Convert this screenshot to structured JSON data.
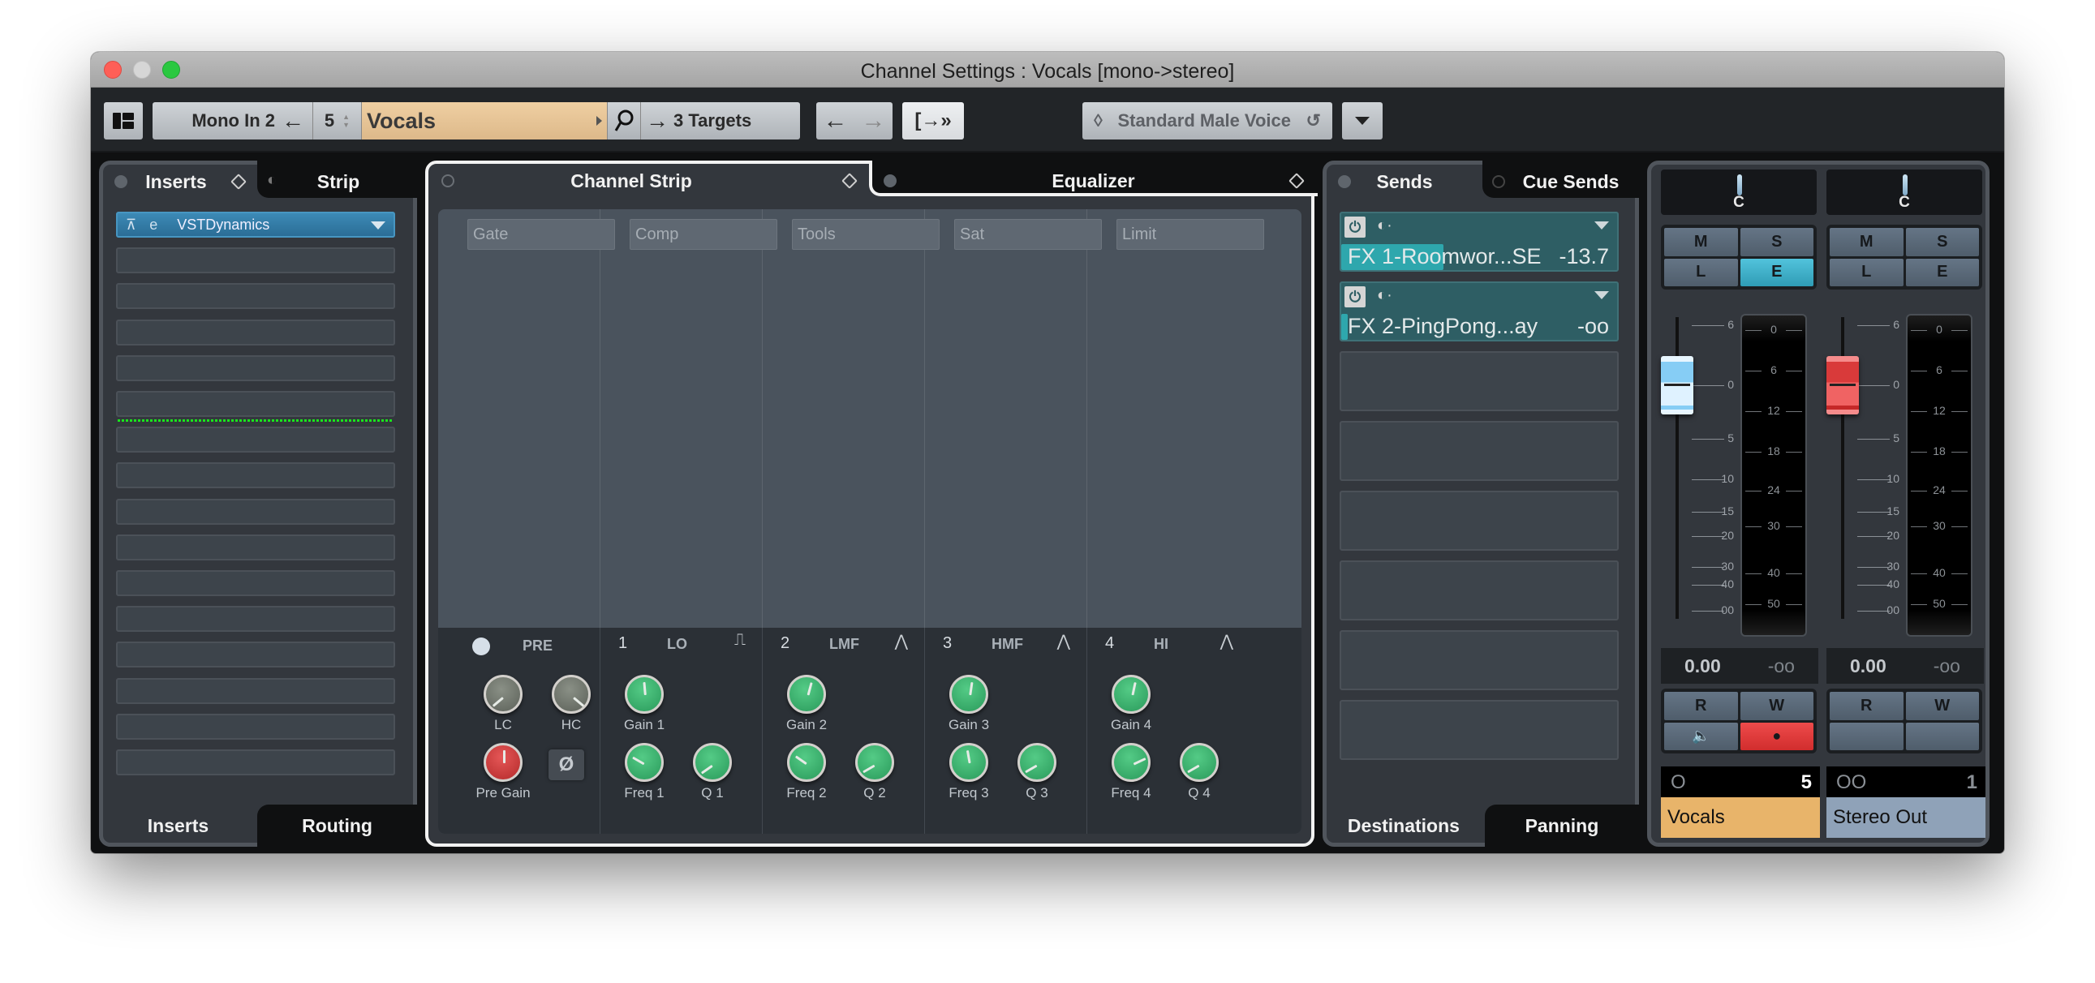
{
  "window": {
    "title": "Channel Settings : Vocals [mono->stereo]"
  },
  "toolbar": {
    "layout_icon": "layout-icon",
    "input_routing": "Mono In 2",
    "input_arrow": "←",
    "channel_number": "5",
    "channel_name": "Vocals",
    "search_icon": "⚲",
    "output_arrow": "→",
    "output_targets": "3 Targets",
    "nav_back": "←",
    "nav_forward": "→",
    "export_icon": "[→»",
    "preset_name": "Standard Male Voice",
    "preset_icon_left": "◊",
    "preset_icon_right": "↺",
    "colors": {
      "channel_name_bg": "#e7c594"
    }
  },
  "inserts_panel": {
    "tabs_top": [
      {
        "label": "Inserts",
        "active": true
      },
      {
        "label": "Strip",
        "active": false
      }
    ],
    "tabs_bottom": [
      {
        "label": "Inserts",
        "active": true
      },
      {
        "label": "Routing",
        "active": false
      }
    ],
    "slots": [
      {
        "name": "VSTDynamics",
        "filled": true
      },
      {
        "name": "",
        "filled": false
      },
      {
        "name": "",
        "filled": false
      },
      {
        "name": "",
        "filled": false
      },
      {
        "name": "",
        "filled": false
      },
      {
        "name": "",
        "filled": false
      },
      {
        "name": "",
        "filled": false
      },
      {
        "name": "",
        "filled": false
      },
      {
        "name": "",
        "filled": false
      },
      {
        "name": "",
        "filled": false
      },
      {
        "name": "",
        "filled": false
      },
      {
        "name": "",
        "filled": false
      },
      {
        "name": "",
        "filled": false
      },
      {
        "name": "",
        "filled": false
      },
      {
        "name": "",
        "filled": false
      },
      {
        "name": "",
        "filled": false
      }
    ],
    "post_fader_divider_after_slot": 6
  },
  "channel_strip_panel": {
    "tabs": [
      {
        "label": "Channel Strip",
        "active": true
      },
      {
        "label": "Equalizer",
        "active": false
      }
    ],
    "modules": [
      "Gate",
      "Comp",
      "Tools",
      "Sat",
      "Limit"
    ],
    "eq": {
      "pre": {
        "label": "PRE",
        "knobs": [
          {
            "label": "LC",
            "color": "grey",
            "angle": -130
          },
          {
            "label": "HC",
            "color": "grey",
            "angle": 130
          },
          {
            "label": "Pre Gain",
            "color": "red",
            "angle": 0
          }
        ],
        "phase_label": "Ø"
      },
      "bands": [
        {
          "num": "1",
          "name": "LO",
          "shape": "⎍",
          "knobs": [
            {
              "label": "Gain 1",
              "angle": -5
            },
            {
              "label": "Freq 1",
              "angle": -60
            },
            {
              "label": "Q 1",
              "angle": -125
            }
          ]
        },
        {
          "num": "2",
          "name": "LMF",
          "shape": "⋀",
          "knobs": [
            {
              "label": "Gain 2",
              "angle": 15
            },
            {
              "label": "Freq 2",
              "angle": -55
            },
            {
              "label": "Q 2",
              "angle": -120
            }
          ]
        },
        {
          "num": "3",
          "name": "HMF",
          "shape": "⋀",
          "knobs": [
            {
              "label": "Gain 3",
              "angle": 8
            },
            {
              "label": "Freq 3",
              "angle": -10
            },
            {
              "label": "Q 3",
              "angle": -120
            }
          ]
        },
        {
          "num": "4",
          "name": "HI",
          "shape": "⋀",
          "knobs": [
            {
              "label": "Gain 4",
              "angle": 12
            },
            {
              "label": "Freq 4",
              "angle": 65
            },
            {
              "label": "Q 4",
              "angle": -120
            }
          ]
        }
      ]
    }
  },
  "sends_panel": {
    "tabs_top": [
      {
        "label": "Sends",
        "active": true
      },
      {
        "label": "Cue Sends",
        "active": false
      }
    ],
    "tabs_bottom": [
      {
        "label": "Destinations",
        "active": true
      },
      {
        "label": "Panning",
        "active": false
      }
    ],
    "sends": [
      {
        "name": "FX 1-Roomwor...SE",
        "value": "-13.7",
        "level": 0.37,
        "filled": true
      },
      {
        "name": "FX 2-PingPong...ay",
        "value": "-oo",
        "level": 0.02,
        "filled": true
      },
      {
        "filled": false
      },
      {
        "filled": false
      },
      {
        "filled": false
      },
      {
        "filled": false
      },
      {
        "filled": false
      },
      {
        "filled": false
      }
    ]
  },
  "mixer": {
    "fader_scale": [
      "6",
      "0",
      "5",
      "10",
      "15",
      "20",
      "30",
      "40",
      "00"
    ],
    "meter_scale": [
      "0",
      "6",
      "12",
      "18",
      "24",
      "30",
      "40",
      "50"
    ],
    "strips": [
      {
        "pan": "C",
        "buttons": [
          "M",
          "S",
          "L",
          "E"
        ],
        "active_button": "E",
        "volume": "0.00",
        "peak": "-oo",
        "fader_db": 0,
        "fader_color": "blue",
        "auto_buttons": [
          "R",
          "W",
          "🔈",
          "●"
        ],
        "record_enabled": true,
        "type_icon": "O",
        "number": "5",
        "name": "Vocals",
        "name_color": "#e8b46a",
        "number_color": "#ffffff"
      },
      {
        "pan": "C",
        "buttons": [
          "M",
          "S",
          "L",
          "E"
        ],
        "active_button": "",
        "volume": "0.00",
        "peak": "-oo",
        "fader_db": 0,
        "fader_color": "red",
        "auto_buttons": [
          "R",
          "W",
          "",
          ""
        ],
        "record_enabled": false,
        "type_icon": "OO",
        "number": "1",
        "name": "Stereo Out",
        "name_color": "#8fa2b8",
        "number_color": "#8a8f95"
      }
    ]
  }
}
